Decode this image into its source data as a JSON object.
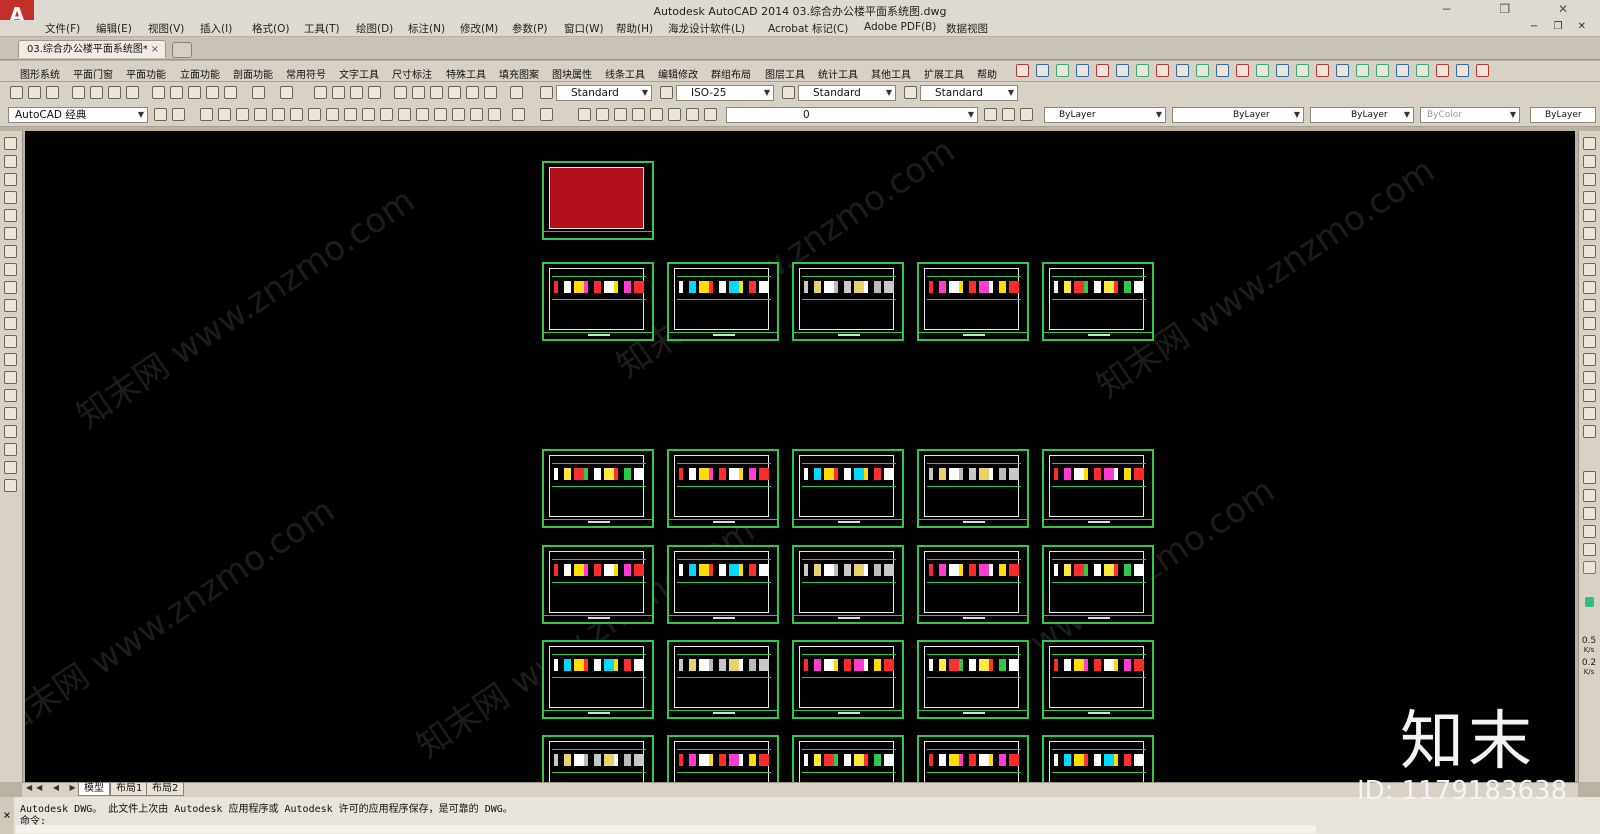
{
  "window": {
    "app_logo": "A",
    "title": "Autodesk AutoCAD 2014    03.综合办公楼平面系统图.dwg",
    "controls": "− ❐ ✕"
  },
  "menubar": {
    "items": [
      "文件(F)",
      "编辑(E)",
      "视图(V)",
      "插入(I)",
      "格式(O)",
      "工具(T)",
      "绘图(D)",
      "标注(N)",
      "修改(M)",
      "参数(P)",
      "窗口(W)",
      "帮助(H)",
      "海龙设计软件(L)",
      "Acrobat 标记(C)",
      "Adobe PDF(B)",
      "数据视图"
    ],
    "mdi_controls": "− ❐ ✕"
  },
  "tabs": {
    "document": "03.综合办公楼平面系统图*",
    "close": "×"
  },
  "ribbon": {
    "items": [
      "图形系统",
      "平面门窗",
      "平面功能",
      "立面功能",
      "剖面功能",
      "常用符号",
      "文字工具",
      "尺寸标注",
      "特殊工具",
      "填充图案",
      "图块属性",
      "线条工具",
      "编辑修改",
      "群组布局",
      "图层工具",
      "统计工具",
      "其他工具",
      "扩展工具",
      "帮助"
    ]
  },
  "styles_toolbar": {
    "text_style": "Standard",
    "dim_style": "ISO-25",
    "table_style": "Standard",
    "multileader_style": "Standard"
  },
  "workspace_toolbar": {
    "workspace": "AutoCAD 经典",
    "layer": "0",
    "color": "ByLayer",
    "linetype": "ByLayer",
    "lineweight": "ByLayer",
    "plotstyle": "ByColor",
    "bylayer": "ByLayer"
  },
  "layout_tabs": {
    "nav": "◀◀ ◀ ▶ ▶▶",
    "items": [
      "模型",
      "布局1",
      "布局2"
    ]
  },
  "command_line": {
    "close": "×",
    "history": "Autodesk DWG。  此文件上次由 Autodesk 应用程序或 Autodesk 许可的应用程序保存，是可靠的 DWG。",
    "prompt": "命令:"
  },
  "right_readouts": {
    "value_1": "0.5",
    "unit_1": "K/s",
    "value_2": "0.2",
    "unit_2": "K/s"
  },
  "watermarks": {
    "site_text": "知末网 www.znzmo.com",
    "brand": "知末",
    "id": "ID: 1179183638"
  },
  "colors": {
    "sheet_border": "#2ec84a",
    "canvas_bg": "#000000",
    "chrome_bg": "#d7d1c6",
    "index_sheet_fill": "#b3121b"
  }
}
